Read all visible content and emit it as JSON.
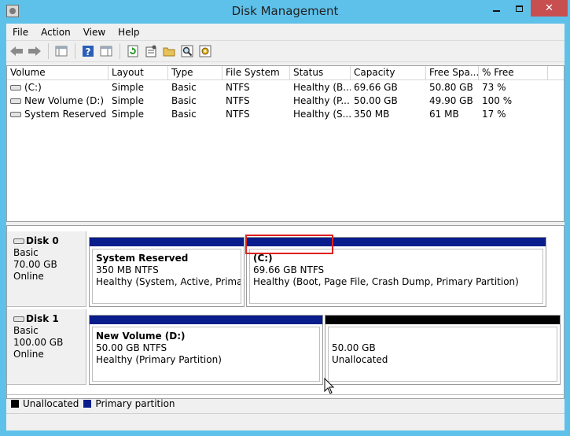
{
  "window": {
    "title": "Disk Management"
  },
  "menu": {
    "items": [
      "File",
      "Action",
      "View",
      "Help"
    ]
  },
  "volume_list": {
    "columns": [
      "Volume",
      "Layout",
      "Type",
      "File System",
      "Status",
      "Capacity",
      "Free Spa...",
      "% Free"
    ],
    "rows": [
      [
        "(C:)",
        "Simple",
        "Basic",
        "NTFS",
        "Healthy (B...",
        "69.66 GB",
        "50.80 GB",
        "73 %"
      ],
      [
        "New Volume (D:)",
        "Simple",
        "Basic",
        "NTFS",
        "Healthy (P...",
        "50.00 GB",
        "49.90 GB",
        "100 %"
      ],
      [
        "System Reserved",
        "Simple",
        "Basic",
        "NTFS",
        "Healthy (S...",
        "350 MB",
        "61 MB",
        "17 %"
      ]
    ]
  },
  "disks": [
    {
      "name": "Disk 0",
      "type": "Basic",
      "size": "70.00 GB",
      "status": "Online",
      "partitions": [
        {
          "name": "System Reserved",
          "size": "350 MB NTFS",
          "status": "Healthy (System, Active, Primary Pa"
        },
        {
          "name": "(C:)",
          "size": "69.66 GB NTFS",
          "status": "Healthy (Boot, Page File, Crash Dump, Primary Partition)"
        }
      ]
    },
    {
      "name": "Disk 1",
      "type": "Basic",
      "size": "100.00 GB",
      "status": "Online",
      "partitions": [
        {
          "name": "New Volume  (D:)",
          "size": "50.00 GB NTFS",
          "status": "Healthy (Primary Partition)"
        },
        {
          "name": "",
          "size": "50.00 GB",
          "status": "Unallocated"
        }
      ]
    }
  ],
  "legend": [
    {
      "label": "Unallocated",
      "color": "#000000"
    },
    {
      "label": "Primary partition",
      "color": "#0a1d8c"
    }
  ],
  "colors": {
    "primary_partition": "#0a1d8c",
    "unallocated": "#000000",
    "highlight": "#e02020",
    "title_bar": "#5ec1ea",
    "close_button": "#c74f50"
  },
  "icons": {
    "toolbar": [
      "back-arrow-icon",
      "forward-arrow-icon",
      "console-tree-icon",
      "help-icon",
      "action-pane-icon",
      "refresh-icon",
      "properties-icon",
      "open-folder-icon",
      "search-disk-icon",
      "settings-icon"
    ]
  }
}
